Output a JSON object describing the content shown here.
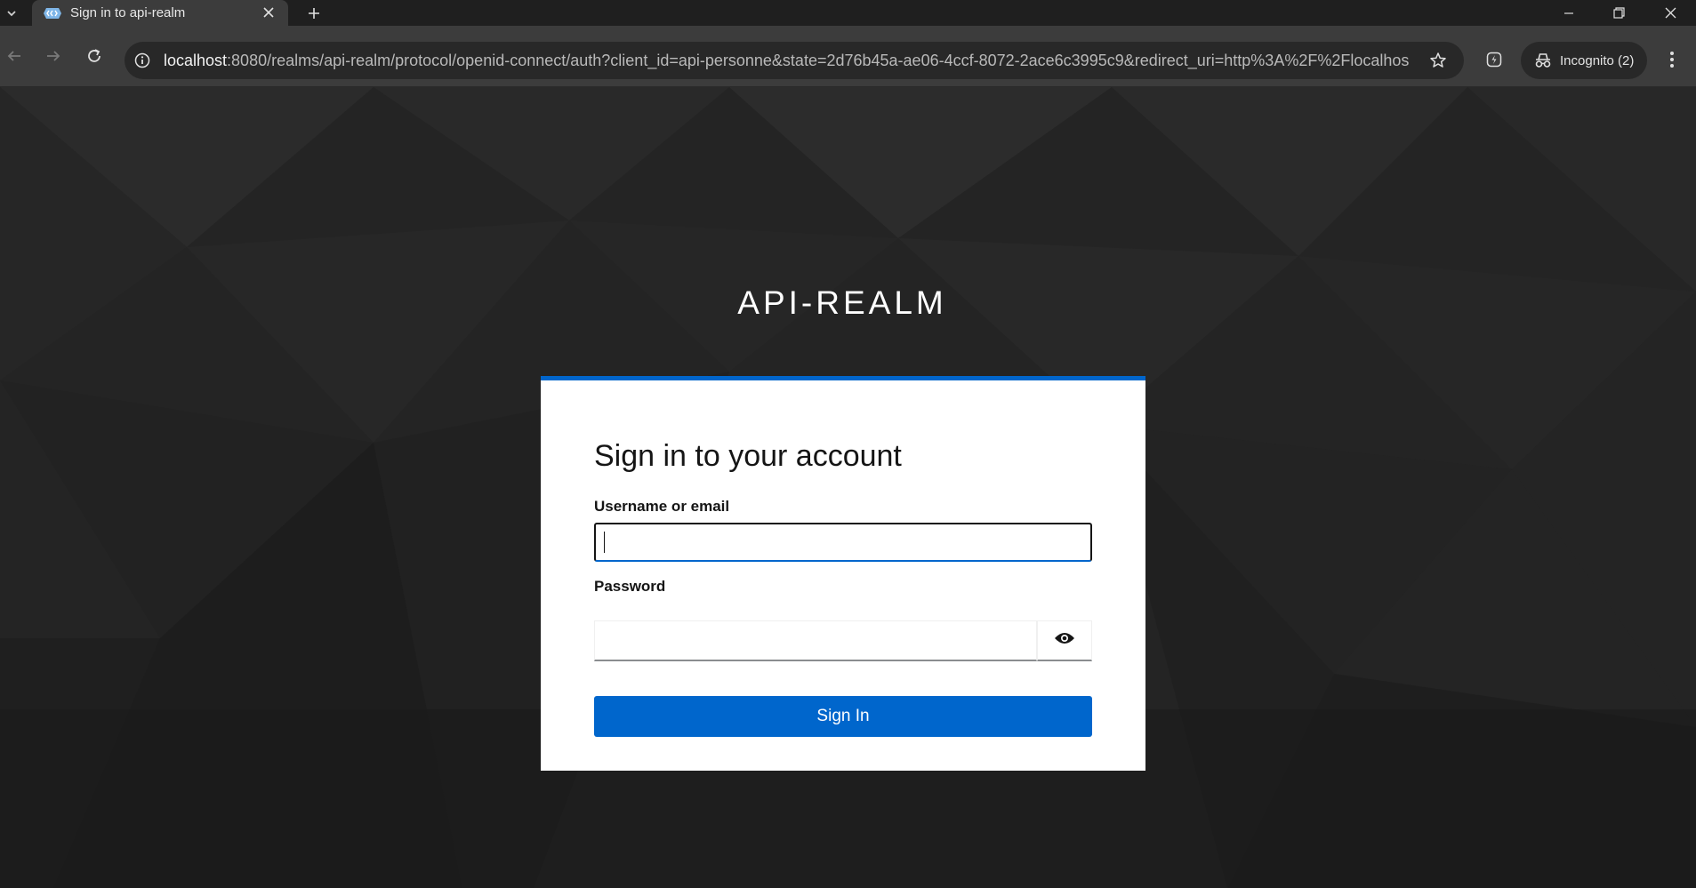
{
  "browser": {
    "tab": {
      "title": "Sign in to api-realm"
    },
    "url": {
      "host": "localhost",
      "rest": ":8080/realms/api-realm/protocol/openid-connect/auth?client_id=api-personne&state=2d76b45a-ae06-4ccf-8072-2ace6c3995c9&redirect_uri=http%3A%2F%2Flocalhost%..."
    },
    "profile": {
      "label": "Incognito (2)"
    },
    "icons": [
      "tab-search-icon",
      "favicon-icon",
      "close-icon",
      "plus-icon",
      "minimize-icon",
      "restore-icon",
      "close-window-icon",
      "back-icon",
      "forward-icon",
      "reload-icon",
      "site-info-icon",
      "star-icon",
      "extension-icon",
      "incognito-icon",
      "more-vert-icon"
    ]
  },
  "page": {
    "realm_title": "API-REALM",
    "heading": "Sign in to your account",
    "username": {
      "label": "Username or email",
      "value": ""
    },
    "password": {
      "label": "Password",
      "value": ""
    },
    "sign_in_label": "Sign In",
    "icons": [
      "eye-icon"
    ]
  },
  "colors": {
    "accent": "#0066cc",
    "page_background": "#242424",
    "chrome_toolbar": "#3c3c3c",
    "chrome_tabstrip": "#1f1f1f",
    "card": "#ffffff"
  }
}
